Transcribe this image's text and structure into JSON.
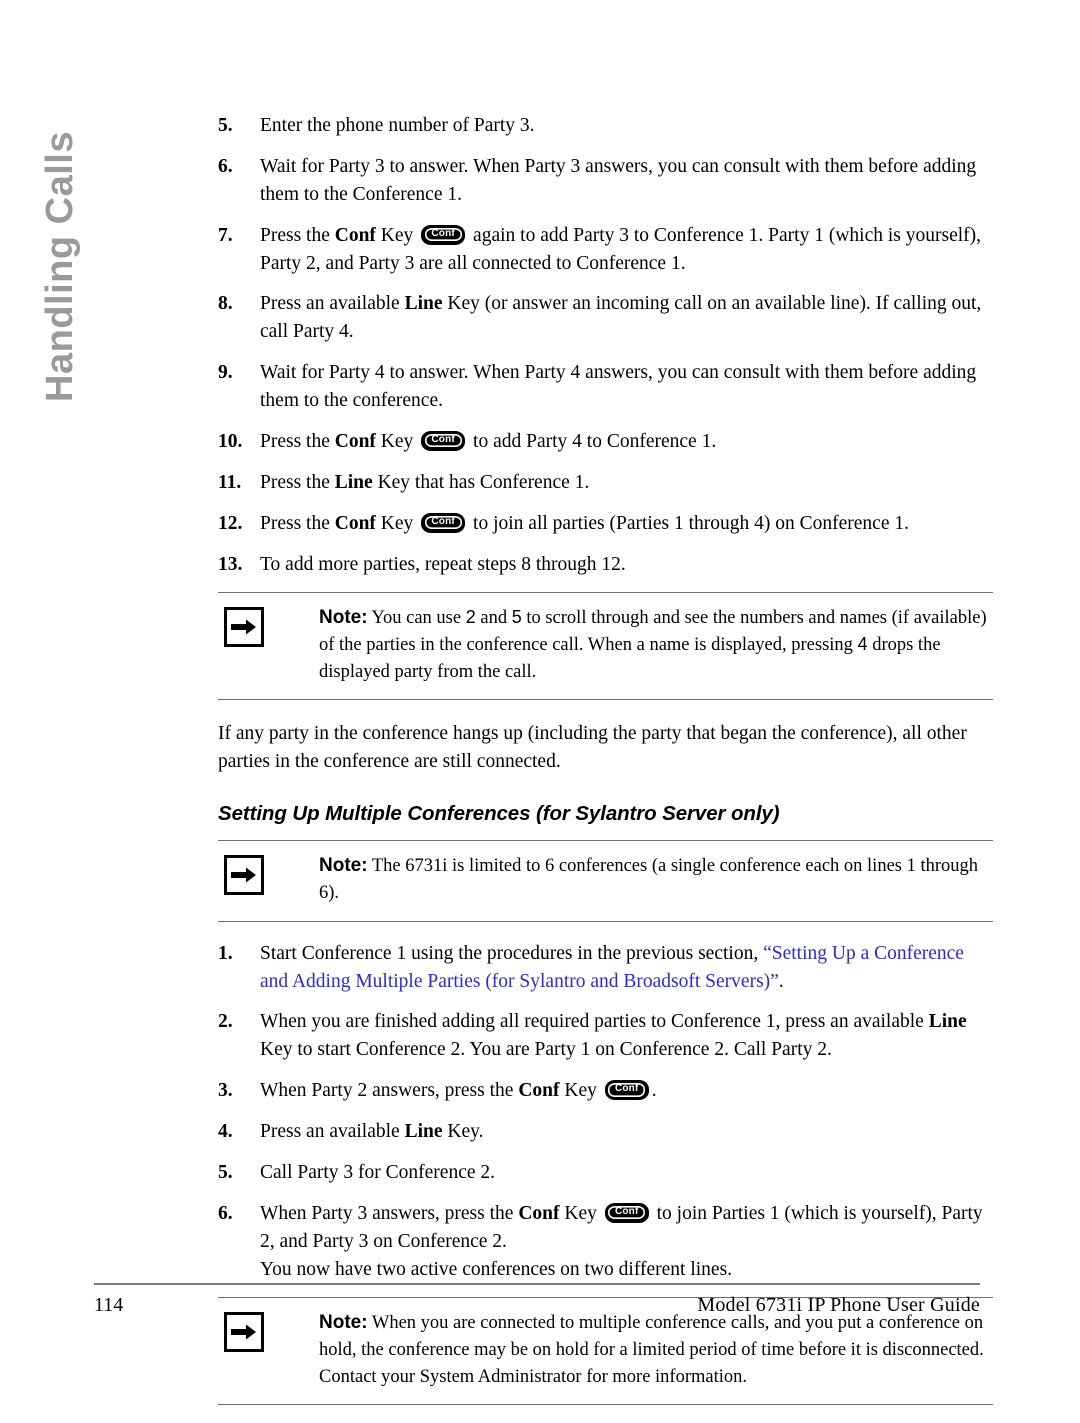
{
  "sidebar": {
    "chapter_label": "Handling Calls",
    "color": "#9a9a9a"
  },
  "link_color": "#2b2bd4",
  "key_glyph": {
    "conf_label": "Conf"
  },
  "steps_group_1": [
    {
      "number": "5.",
      "lines": [
        "Enter the phone number of Party 3."
      ]
    },
    {
      "number": "6.",
      "lines": [
        "Wait for Party 3 to answer. When Party 3 answers, you can consult with them before adding them to the Conference 1."
      ]
    },
    {
      "number": "7.",
      "pre": "Press the ",
      "bold1": "Conf",
      "mid": " Key ",
      "post": " again to add Party 3 to Conference 1. Party 1 (which is yourself), Party 2, and Party 3 are all connected to Conference 1."
    },
    {
      "number": "8.",
      "pre": "Press an available ",
      "bold1": "Line",
      "post": " Key (or answer an incoming call on an available line). If calling out, call Party 4."
    },
    {
      "number": "9.",
      "lines": [
        "Wait for Party 4 to answer. When Party 4 answers, you can consult with them before adding them to the conference."
      ]
    },
    {
      "number": "10.",
      "pre": "Press the ",
      "bold1": "Conf",
      "mid": " Key ",
      "post": " to add Party 4 to Conference 1."
    },
    {
      "number": "11.",
      "pre": "Press the ",
      "bold1": "Line",
      "post": " Key that has Conference 1."
    },
    {
      "number": "12.",
      "pre": "Press the ",
      "bold1": "Conf",
      "mid": " Key ",
      "post": " to join all parties (Parties 1 through 4) on Conference 1."
    },
    {
      "number": "13.",
      "lines": [
        "To add more parties, repeat steps 8 through 12."
      ]
    }
  ],
  "note_1": {
    "icon": "arrow-right-icon",
    "label": "Note:",
    "part_a": " You can use ",
    "digit_1": "2",
    "part_b": " and ",
    "digit_2": "5",
    "part_c": " to scroll through and see the numbers and names (if available) of the parties in the conference call. When a name is displayed, pressing ",
    "digit_3": "4",
    "part_d": "  drops the displayed party from the call."
  },
  "paragraph_1": "If any party in the conference hangs up (including the party that began the conference), all other parties in the conference are still connected.",
  "heading_1": "Setting Up Multiple Conferences (for Sylantro Server only)",
  "note_2": {
    "icon": "arrow-right-icon",
    "label": "Note:",
    "text": " The 6731i is limited to 6 conferences (a single conference each on lines 1 through 6)."
  },
  "steps_group_2": [
    {
      "number": "1.",
      "pre": "Start Conference 1 using the procedures in the previous section, ",
      "link": "“Setting Up a Conference and Adding Multiple Parties (for Sylantro and Broadsoft Servers)”",
      "post": "."
    },
    {
      "number": "2.",
      "pre": "When you are finished adding all required parties to Conference 1, press an available ",
      "bold1": "Line",
      "post": " Key to start Conference 2. You are Party 1 on Conference 2. Call Party 2."
    },
    {
      "number": "3.",
      "pre": "When Party 2 answers, press the ",
      "bold1": "Conf",
      "mid": " Key ",
      "post": "."
    },
    {
      "number": "4.",
      "pre": "Press an available ",
      "bold1": "Line",
      "post": " Key."
    },
    {
      "number": "5.",
      "lines": [
        "Call Party 3 for Conference 2."
      ]
    },
    {
      "number": "6.",
      "pre": "When Party 3 answers, press the ",
      "bold1": "Conf",
      "mid": " Key ",
      "post": " to join Parties 1 (which is yourself), Party 2, and Party 3 on Conference 2.",
      "extra_line": "You now have two active conferences on two different lines."
    }
  ],
  "note_3": {
    "icon": "arrow-right-icon",
    "label": "Note:",
    "text": " When you are connected to multiple conference calls, and you put a conference on hold, the conference may be on hold for a limited period of time before it is disconnected. Contact your System Administrator for more information."
  },
  "footer": {
    "page_number": "114",
    "guide_title": "Model 6731i IP Phone User Guide"
  }
}
